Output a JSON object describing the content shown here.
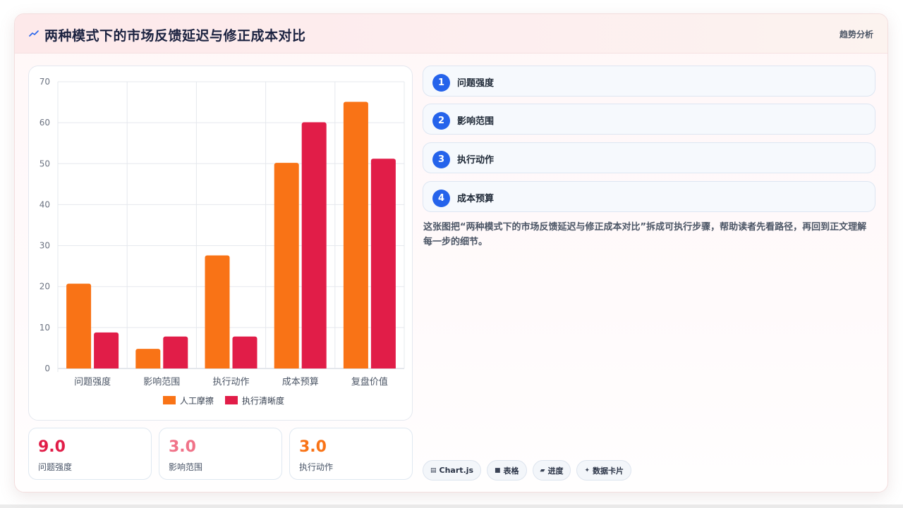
{
  "header": {
    "title": "两种模式下的市场反馈延迟与修正成本对比",
    "tag": "趋势分析",
    "icon": "trend-line-icon"
  },
  "chart_data": {
    "type": "bar",
    "categories": [
      "问题强度",
      "影响范围",
      "执行动作",
      "成本预算",
      "复盘价值"
    ],
    "series": [
      {
        "name": "人工摩擦",
        "color": "#f97316",
        "values": [
          20.7,
          4.8,
          27.6,
          50.2,
          65.1
        ]
      },
      {
        "name": "执行清晰度",
        "color": "#e11d48",
        "values": [
          8.8,
          7.8,
          7.8,
          60.1,
          51.2
        ]
      }
    ],
    "ylim": [
      0,
      70
    ],
    "yticks": [
      0,
      10,
      20,
      30,
      40,
      50,
      60,
      70
    ],
    "grid": true,
    "legend": "bottom"
  },
  "kpis": [
    {
      "value": "9.0",
      "label": "问题强度",
      "color": "#e11d48"
    },
    {
      "value": "3.0",
      "label": "影响范围",
      "color": "#f07288"
    },
    {
      "value": "3.0",
      "label": "执行动作",
      "color": "#f97316"
    }
  ],
  "steps": [
    {
      "num": "1",
      "label": "问题强度"
    },
    {
      "num": "2",
      "label": "影响范围"
    },
    {
      "num": "3",
      "label": "执行动作"
    },
    {
      "num": "4",
      "label": "成本预算"
    }
  ],
  "description": "这张图把“两种模式下的市场反馈延迟与修正成本对比”拆成可执行步骤，帮助读者先看路径，再回到正文理解每一步的细节。",
  "chips": [
    {
      "icon": "chart-icon",
      "glyph": "▤",
      "label": "Chart.js"
    },
    {
      "icon": "table-icon",
      "glyph": "■",
      "label": "表格"
    },
    {
      "icon": "progress-icon",
      "glyph": "▰",
      "label": "进度"
    },
    {
      "icon": "sparkle-icon",
      "glyph": "✦",
      "label": "数据卡片"
    }
  ]
}
